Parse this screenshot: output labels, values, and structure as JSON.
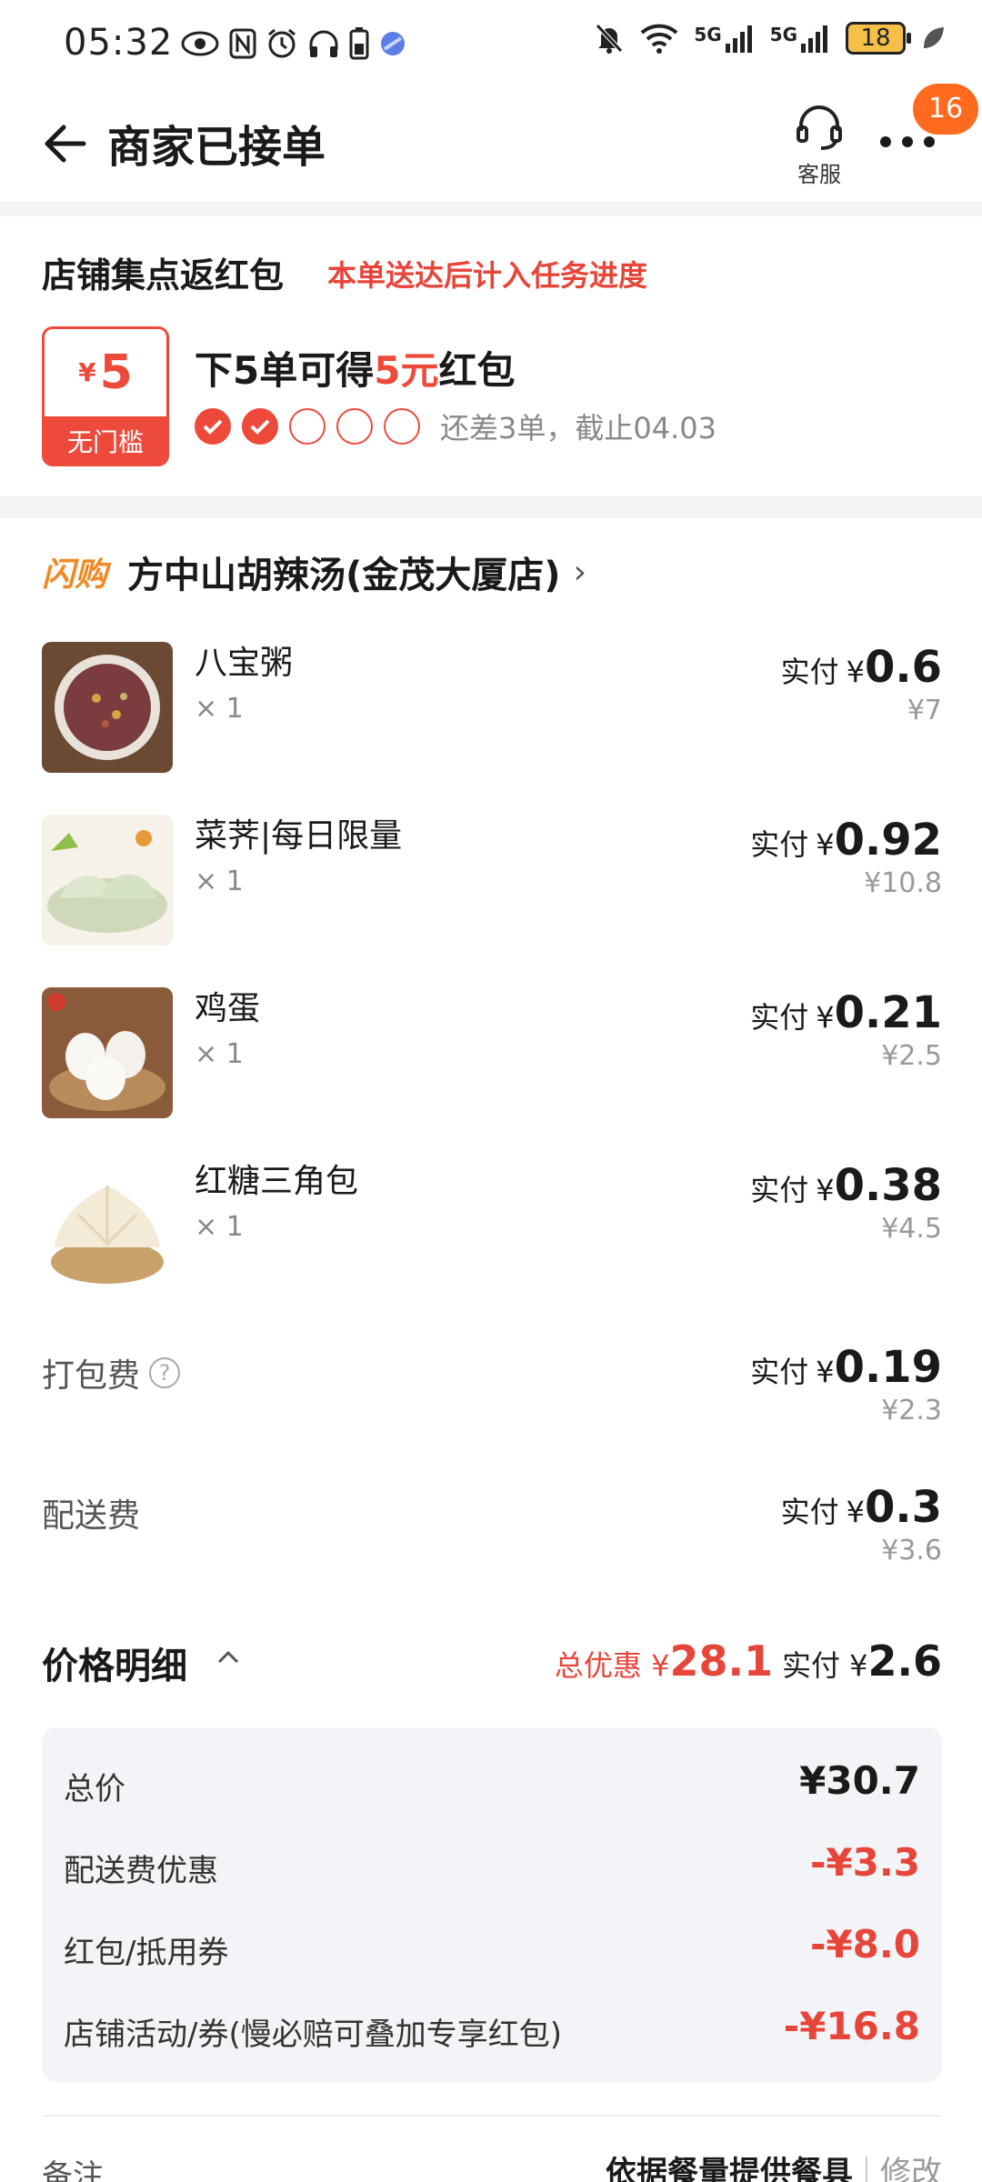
{
  "status_bar": {
    "time": "05:32",
    "battery": "18",
    "signal1": "5G",
    "signal2": "5G"
  },
  "nav": {
    "title": "商家已接单",
    "customer_service_label": "客服",
    "more_badge": "16"
  },
  "reward": {
    "title": "店铺集点返红包",
    "subtitle": "本单送达后计入任务进度",
    "coupon_currency": "¥",
    "coupon_amount": "5",
    "coupon_note": "无门槛",
    "main_prefix": "下5单可得",
    "main_highlight": "5元",
    "main_suffix": "红包",
    "progress_done": 2,
    "progress_total": 5,
    "progress_text": "还差3单，截止04.03"
  },
  "shop": {
    "tag": "闪购",
    "name": "方中山胡辣汤(金茂大厦店)"
  },
  "items": [
    {
      "name": "八宝粥",
      "qty": "× 1",
      "pay_label": "实付",
      "currency": "¥",
      "paid": "0.6",
      "original": "¥7"
    },
    {
      "name": "菜荠|每日限量",
      "qty": "× 1",
      "pay_label": "实付",
      "currency": "¥",
      "paid": "0.92",
      "original": "¥10.8"
    },
    {
      "name": "鸡蛋",
      "qty": "× 1",
      "pay_label": "实付",
      "currency": "¥",
      "paid": "0.21",
      "original": "¥2.5"
    },
    {
      "name": "红糖三角包",
      "qty": "× 1",
      "pay_label": "实付",
      "currency": "¥",
      "paid": "0.38",
      "original": "¥4.5"
    }
  ],
  "fees": [
    {
      "label": "打包费",
      "pay_label": "实付",
      "currency": "¥",
      "paid": "0.19",
      "original": "¥2.3"
    },
    {
      "label": "配送费",
      "pay_label": "实付",
      "currency": "¥",
      "paid": "0.3",
      "original": "¥3.6"
    }
  ],
  "price_detail": {
    "title": "价格明细",
    "discount_label": "总优惠",
    "discount_currency": "¥",
    "discount_amount": "28.1",
    "paid_label": "实付",
    "paid_currency": "¥",
    "paid_amount": "2.6",
    "rows": [
      {
        "label": "总价",
        "value": "¥30.7"
      },
      {
        "label": "配送费优惠",
        "value": "-¥3.3"
      },
      {
        "label": "红包/抵用券",
        "value": "-¥8.0"
      },
      {
        "label": "店铺活动/券(慢必赔可叠加专享红包)",
        "value": "-¥16.8"
      }
    ]
  },
  "note": {
    "label": "备注",
    "value": "依据餐量提供餐具",
    "edit": "修改"
  },
  "colors": {
    "accent_red": "#ee4a3b",
    "flash_orange": "#f08a24",
    "badge_orange": "#ff6a1f"
  }
}
